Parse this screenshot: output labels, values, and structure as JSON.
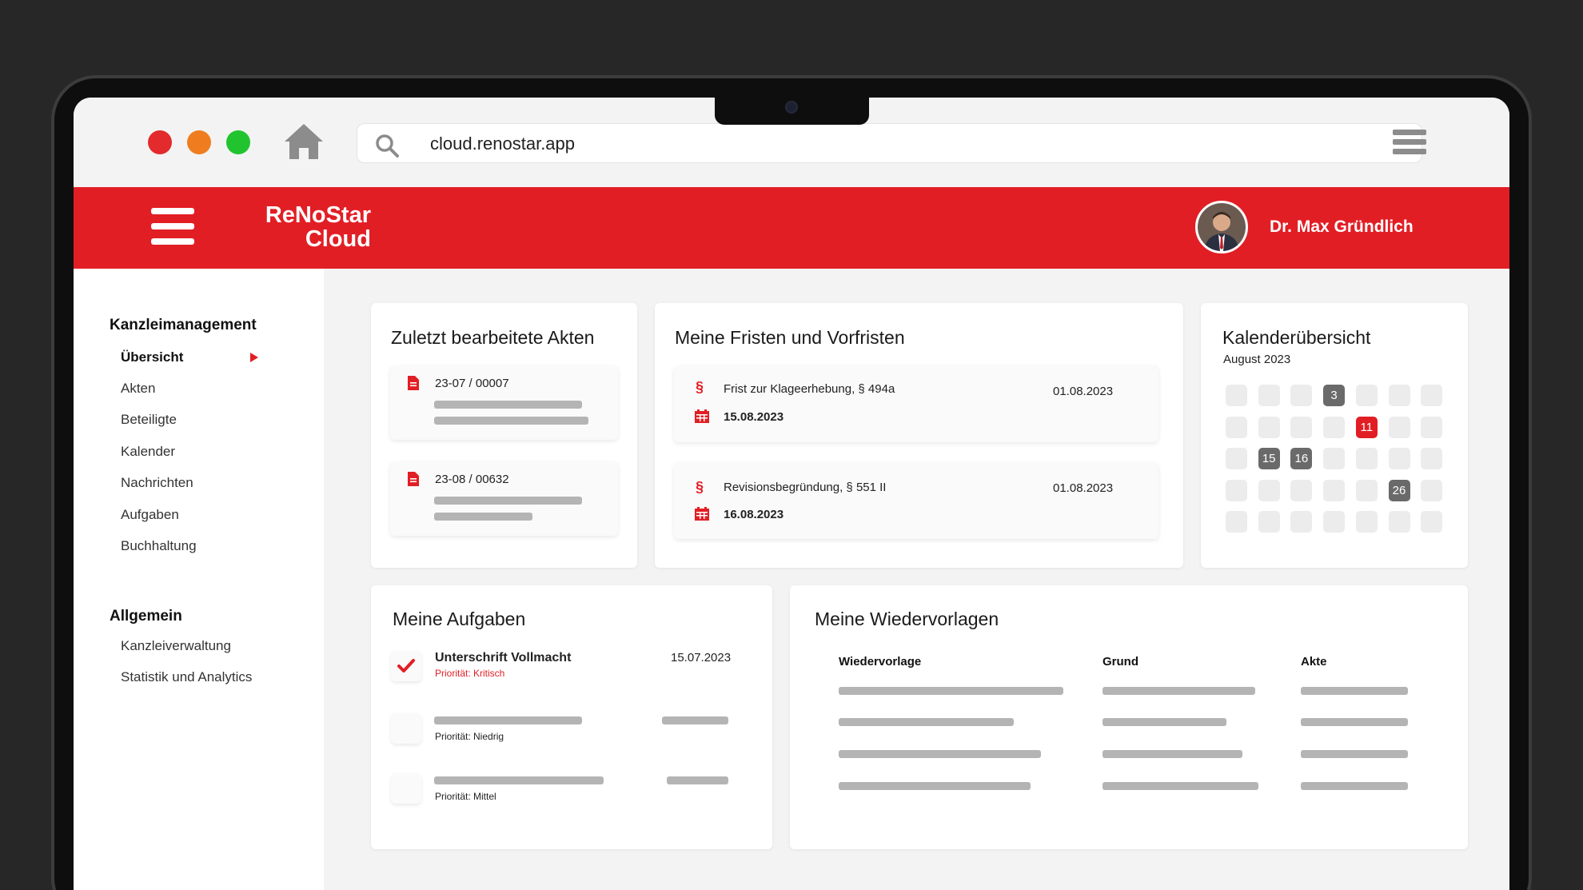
{
  "browser": {
    "url": "cloud.renostar.app"
  },
  "app": {
    "logo_line1": "ReNoStar",
    "logo_line2": "Cloud",
    "user_name": "Dr. Max Gründlich",
    "accent_color": "#e21e25"
  },
  "sidebar": {
    "section1_title": "Kanzleimanagement",
    "section1_items": [
      "Übersicht",
      "Akten",
      "Beteiligte",
      "Kalender",
      "Nachrichten",
      "Aufgaben",
      "Buchhaltung"
    ],
    "active_item": "Übersicht",
    "section2_title": "Allgemein",
    "section2_items": [
      "Kanzleiverwaltung",
      "Statistik und Analytics"
    ]
  },
  "recent_files": {
    "title": "Zuletzt bearbeitete Akten",
    "items": [
      {
        "number": "23-07 / 00007"
      },
      {
        "number": "23-08 / 00632"
      }
    ]
  },
  "deadlines": {
    "title": "Meine Fristen und Vorfristen",
    "items": [
      {
        "label": "Frist zur Klageerhebung, § 494a",
        "date_pre": "01.08.2023",
        "date_due": "15.08.2023"
      },
      {
        "label": "Revisionsbegründung, § 551 II",
        "date_pre": "01.08.2023",
        "date_due": "16.08.2023"
      }
    ]
  },
  "calendar": {
    "title": "Kalenderübersicht",
    "month": "August 2023",
    "marked_days": [
      {
        "day": "3",
        "style": "dark"
      },
      {
        "day": "11",
        "style": "red"
      },
      {
        "day": "15",
        "style": "dark"
      },
      {
        "day": "16",
        "style": "dark"
      },
      {
        "day": "26",
        "style": "dark"
      }
    ]
  },
  "tasks": {
    "title": "Meine Aufgaben",
    "items": [
      {
        "title": "Unterschrift Vollmacht",
        "date": "15.07.2023",
        "priority": "Priorität: Kritisch",
        "done": true
      },
      {
        "title": "",
        "date": "",
        "priority": "Priorität: Niedrig",
        "done": false
      },
      {
        "title": "",
        "date": "",
        "priority": "Priorität: Mittel",
        "done": false
      }
    ]
  },
  "resubmissions": {
    "title": "Meine Wiedervorlagen",
    "columns": [
      "Wiedervorlage",
      "Grund",
      "Akte"
    ]
  }
}
